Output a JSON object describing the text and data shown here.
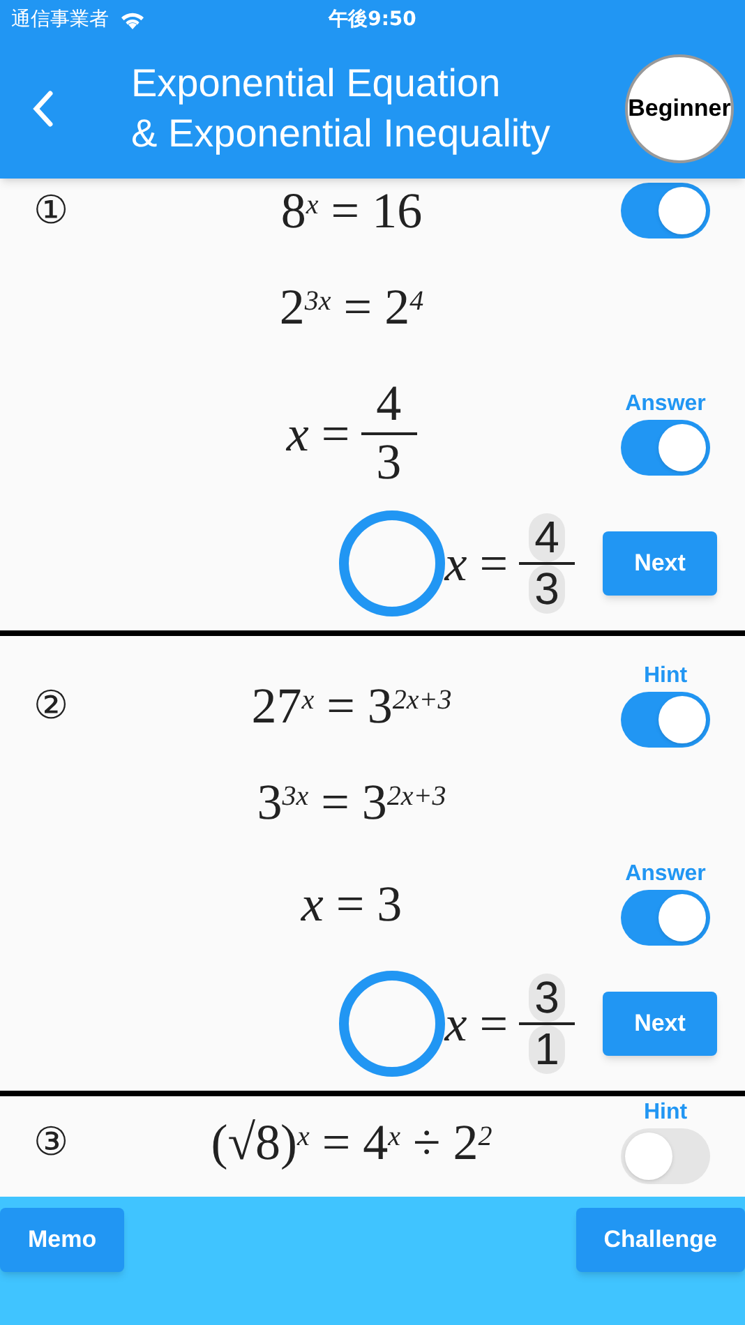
{
  "status_bar": {
    "carrier": "通信事業者",
    "time": "午後9:50"
  },
  "header": {
    "title_lines": [
      "Exponential Equation",
      "& Exponential Inequality"
    ],
    "level_badge": "Beginner"
  },
  "problems": [
    {
      "number": "①",
      "hint": {
        "on": true
      },
      "answer": {
        "label": "Answer",
        "on": true
      },
      "lines": [
        {
          "kind": "plain",
          "text": "8$^{x}$ = 16"
        },
        {
          "kind": "plain",
          "text": "2$^{3x}$ = 2$^{4}$"
        },
        {
          "kind": "fraction",
          "lhs": "*x* =",
          "num": "4",
          "den": "3"
        }
      ],
      "result": {
        "correct": true,
        "lhs": "*x* =",
        "num": "4",
        "den": "3"
      },
      "next": "Next"
    },
    {
      "number": "②",
      "hint": {
        "label": "Hint",
        "on": true
      },
      "answer": {
        "label": "Answer",
        "on": true
      },
      "lines": [
        {
          "kind": "plain",
          "text": "27$^{x}$ = 3$^{2x+3}$"
        },
        {
          "kind": "plain",
          "text": "3$^{3x}$ = 3$^{2x+3}$"
        },
        {
          "kind": "plain",
          "text": "*x* = 3"
        }
      ],
      "result": {
        "correct": true,
        "lhs": "*x* =",
        "num": "3",
        "den": "1"
      },
      "next": "Next"
    },
    {
      "number": "③",
      "hint": {
        "label": "Hint",
        "on": false
      },
      "lines": [
        {
          "kind": "plain",
          "text": "(√8)$^{x}$ = 4$^{x}$ ÷ 2$^{2}$"
        }
      ]
    }
  ],
  "footer": {
    "buttons": [
      "Memo",
      "Challenge"
    ]
  }
}
